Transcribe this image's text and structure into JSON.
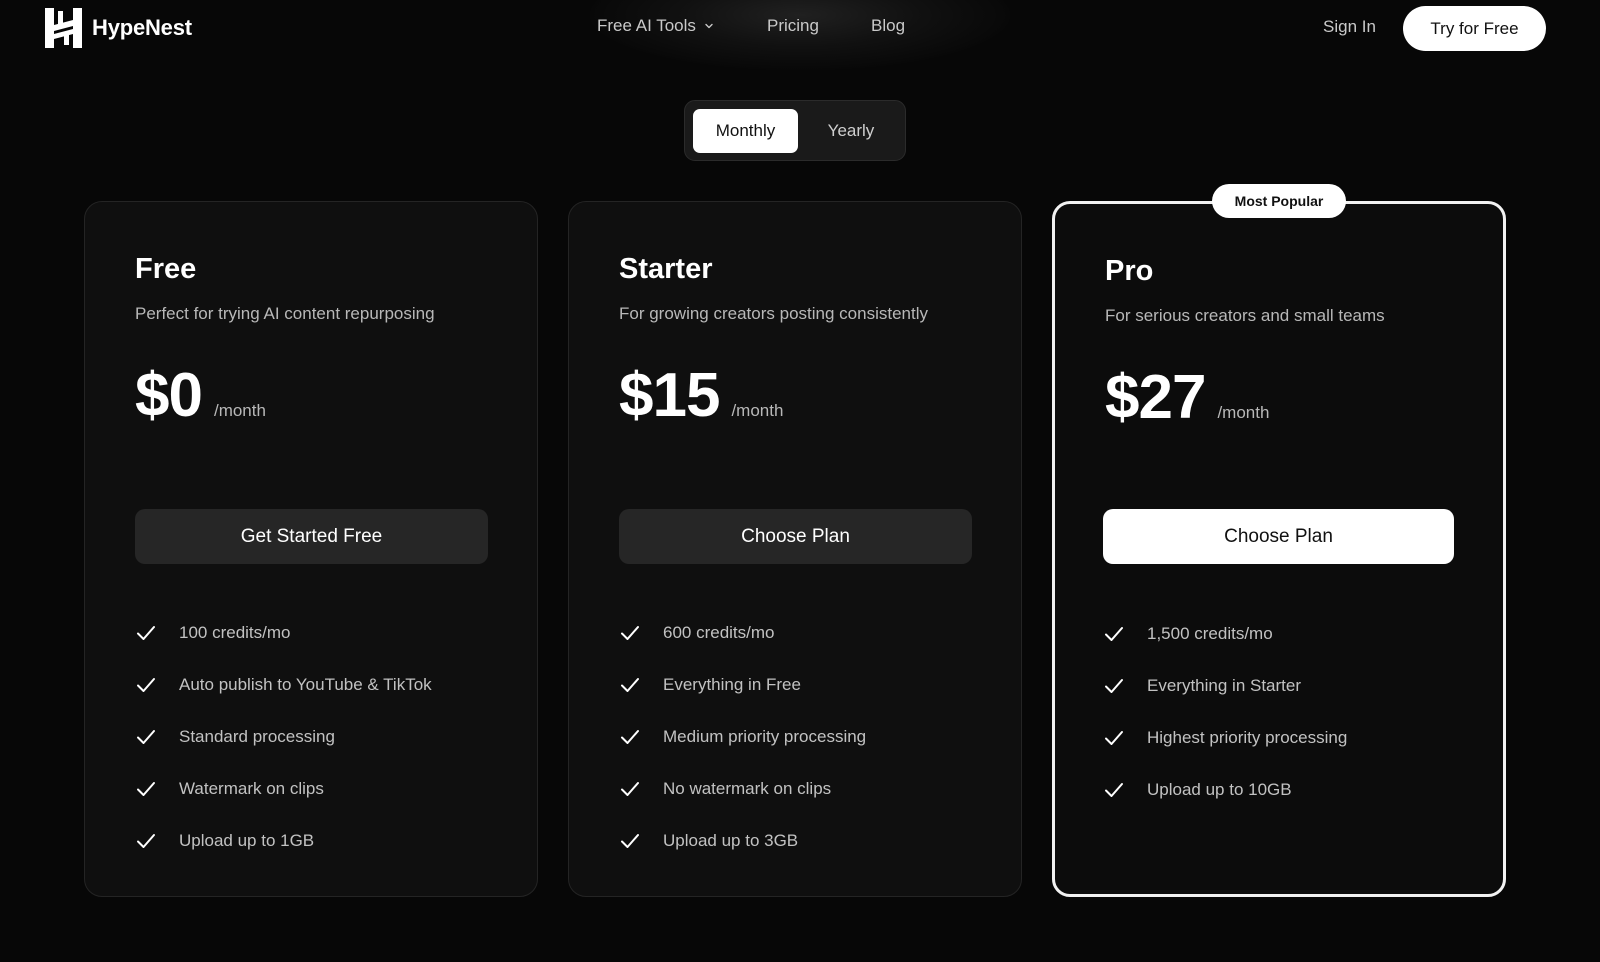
{
  "brand": {
    "name": "HypeNest"
  },
  "nav": {
    "items": [
      {
        "label": "Free AI Tools",
        "has_dropdown": true
      },
      {
        "label": "Pricing",
        "has_dropdown": false
      },
      {
        "label": "Blog",
        "has_dropdown": false
      }
    ],
    "sign_in": "Sign In",
    "cta": "Try for Free"
  },
  "billing_toggle": {
    "options": [
      "Monthly",
      "Yearly"
    ],
    "selected": "Monthly"
  },
  "plans": [
    {
      "name": "Free",
      "description": "Perfect for trying AI content repurposing",
      "price": "$0",
      "period": "/month",
      "cta": "Get Started Free",
      "features": [
        "100 credits/mo",
        "Auto publish to YouTube & TikTok",
        "Standard processing",
        "Watermark on clips",
        "Upload up to 1GB"
      ]
    },
    {
      "name": "Starter",
      "description": "For growing creators posting consistently",
      "price": "$15",
      "period": "/month",
      "cta": "Choose Plan",
      "features": [
        "600 credits/mo",
        "Everything in Free",
        "Medium priority processing",
        "No watermark on clips",
        "Upload up to 3GB"
      ]
    },
    {
      "name": "Pro",
      "badge": "Most Popular",
      "description": "For serious creators and small teams",
      "price": "$27",
      "period": "/month",
      "cta": "Choose Plan",
      "features": [
        "1,500 credits/mo",
        "Everything in Starter",
        "Highest priority processing",
        "Upload up to 10GB"
      ]
    }
  ],
  "colors": {
    "background": "#070707",
    "card": "#0f0f0f",
    "card_border": "#242424",
    "highlight_border": "#f2f2f2",
    "text_primary": "#ffffff",
    "text_secondary": "#b8b8b8",
    "button_dark": "#262626",
    "button_light": "#ffffff"
  },
  "icons": {
    "logo": "hypenest-logo-icon",
    "dropdown": "chevron-down-icon",
    "feature": "check-icon"
  }
}
